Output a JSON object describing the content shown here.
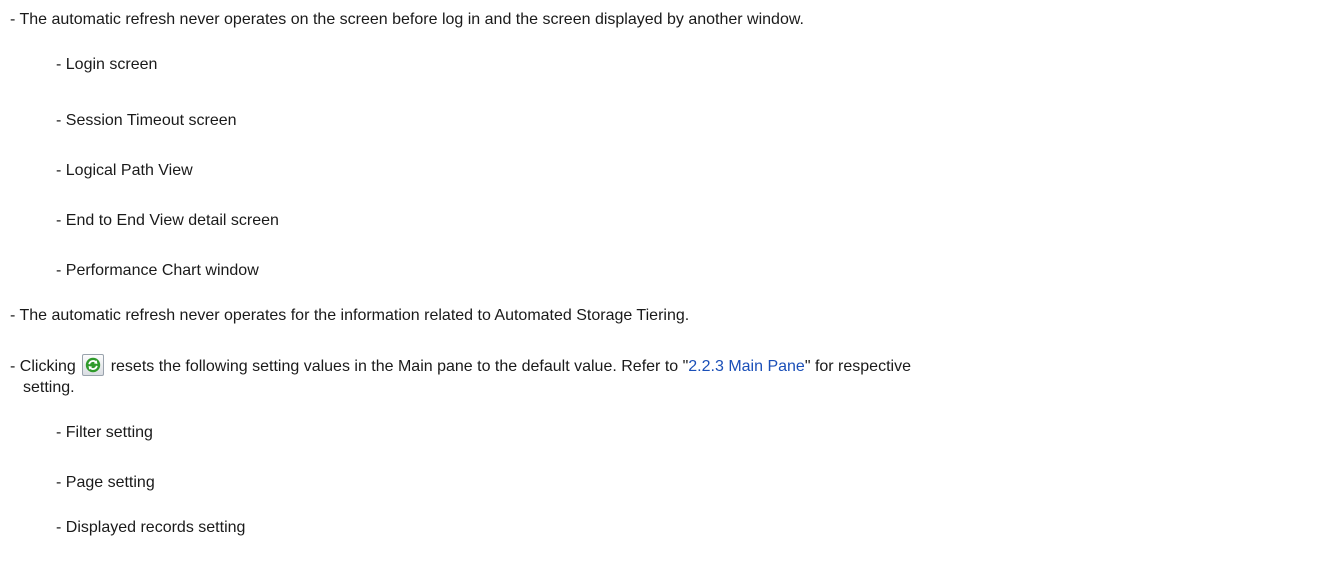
{
  "items": [
    {
      "text": "- The automatic refresh never operates on the screen before log in and the screen displayed by another window."
    },
    {
      "text": "- Login screen"
    },
    {
      "text": "- Session Timeout screen"
    },
    {
      "text": "- Logical Path View"
    },
    {
      "text": "- End to End View detail screen"
    },
    {
      "text": "- Performance Chart window"
    },
    {
      "text": "- The automatic refresh never operates for the information related to Automated Storage Tiering."
    },
    {
      "text": "- Filter setting"
    },
    {
      "text": "- Page setting"
    },
    {
      "text": "- Displayed records setting"
    }
  ],
  "refresh_item": {
    "before_icon": "- Clicking",
    "icon": "refresh-icon",
    "after_icon": "resets the following setting values in the Main pane to the default value. Refer to \"",
    "link_text": "2.2.3 Main Pane",
    "after_link": "\" for respective",
    "continuation": "setting."
  },
  "colors": {
    "link": "#1a4fb8",
    "icon_green": "#2f9a2b"
  }
}
